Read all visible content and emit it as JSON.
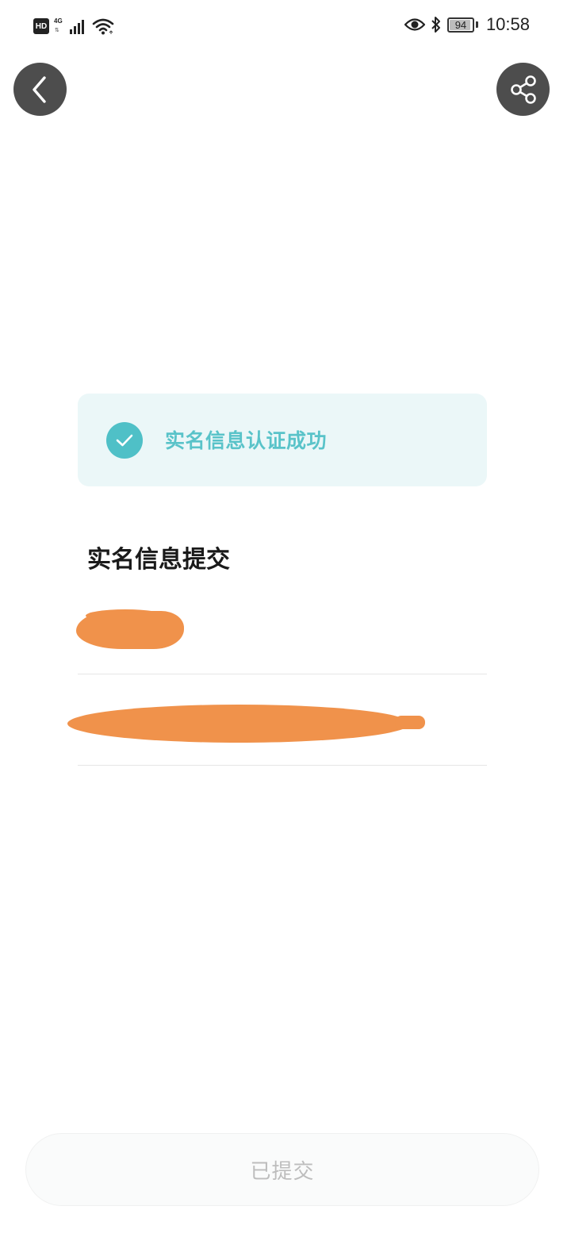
{
  "status_bar": {
    "hd_badge": "HD",
    "network": "4G",
    "battery_level": 94,
    "battery_text": "94",
    "time": "10:58",
    "icons": [
      "signal-icon",
      "wifi-icon",
      "eye-icon",
      "bluetooth-icon",
      "battery-icon"
    ]
  },
  "nav": {
    "back_icon": "chevron-left-icon",
    "share_icon": "share-icon"
  },
  "success_banner": {
    "icon": "check-circle-icon",
    "text": "实名信息认证成功",
    "accent_color": "#4fc0c7"
  },
  "section": {
    "title": "实名信息提交"
  },
  "fields": [
    {
      "name": "real-name",
      "value": ""
    },
    {
      "name": "id-number",
      "value": ""
    }
  ],
  "submit_button": {
    "label": "已提交",
    "disabled": true
  }
}
